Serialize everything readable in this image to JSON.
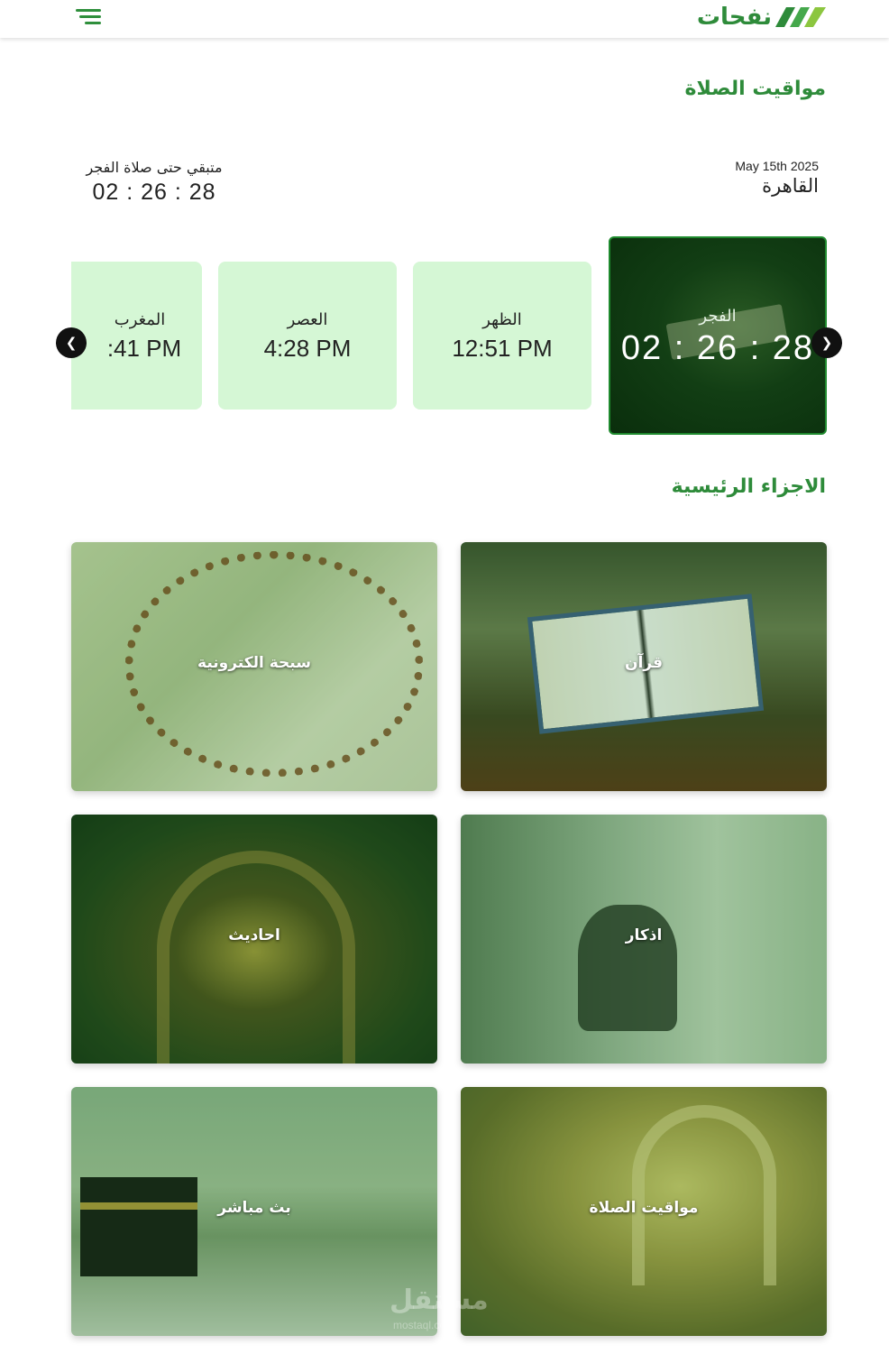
{
  "header": {
    "logo_text": "نفحات",
    "menu_icon": "hamburger-menu-icon"
  },
  "prayer_section": {
    "title": "مواقيت الصلاة",
    "date": "May 15th 2025",
    "city": "القاهرة",
    "remaining_label": "متبقي حتى صلاة الفجر",
    "remaining_time": "02 : 26 : 28"
  },
  "prayers": [
    {
      "name": "الفجر",
      "time": "02 : 26 : 28",
      "active": true
    },
    {
      "name": "الظهر",
      "time": "12:51 PM"
    },
    {
      "name": "العصر",
      "time": "4:28 PM"
    },
    {
      "name": "المغرب",
      "time": ":41 PM"
    }
  ],
  "carousel": {
    "prev_icon": "chevron-left-icon",
    "next_icon": "chevron-right-icon"
  },
  "main_section": {
    "title": "الاجزاء الرئيسية",
    "items": [
      {
        "label": "قرآن"
      },
      {
        "label": "سبحة الكترونية"
      },
      {
        "label": "اذكار"
      },
      {
        "label": "احاديث"
      },
      {
        "label": "مواقيت الصلاة"
      },
      {
        "label": "بث مباشر"
      }
    ]
  },
  "watermark": {
    "text": "مستقل",
    "sub": "mostaql.com"
  },
  "colors": {
    "brand": "#2e8b3a",
    "card_bg": "#d5f7d5",
    "active_card": "#123e14"
  }
}
